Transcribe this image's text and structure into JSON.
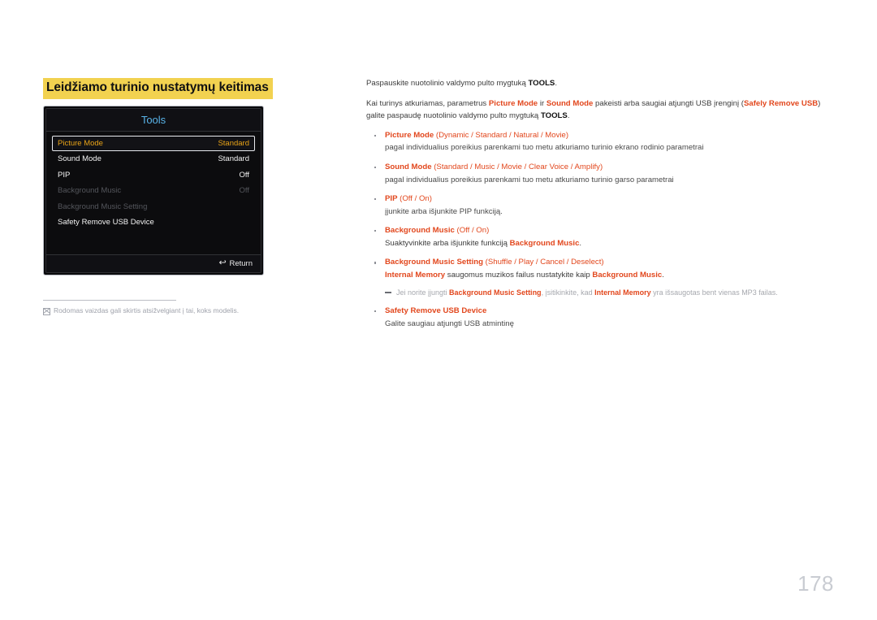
{
  "section": {
    "title": "Leidžiamo turinio nustatymų keitimas",
    "highlight_color": "#f2d250"
  },
  "osd": {
    "header_title": "Tools",
    "header_color": "#59b3e8",
    "selected_color": "#e8a317",
    "rows": [
      {
        "label": "Picture Mode",
        "value": "Standard",
        "state": "selected"
      },
      {
        "label": "Sound Mode",
        "value": "Standard",
        "state": "enabled"
      },
      {
        "label": "PIP",
        "value": "Off",
        "state": "enabled"
      },
      {
        "label": "Background Music",
        "value": "Off",
        "state": "disabled"
      },
      {
        "label": "Background Music Setting",
        "value": "",
        "state": "disabled"
      },
      {
        "label": "Safety Remove USB Device",
        "value": "",
        "state": "enabled"
      }
    ],
    "return_label": "Return",
    "return_icon": "return-arrow-icon"
  },
  "footnote": {
    "icon": "note-box-icon",
    "text": "Rodomas vaizdas gali skirtis atsižvelgiant į tai, koks modelis."
  },
  "body": {
    "paragraph1": {
      "pre": "Paspauskite nuotolinio valdymo pulto mygtuką ",
      "emphasis": "TOOLS",
      "post": "."
    },
    "paragraph2": {
      "p1": "Kai turinys atkuriamas, parametrus ",
      "e1": "Picture Mode",
      "p2": " ir ",
      "e2": "Sound Mode",
      "p3": " pakeisti arba saugiai atjungti USB įrenginį (",
      "e3": "Safely Remove USB",
      "p4": ") galite paspaudę nuotolinio valdymo pulto mygtuką ",
      "e4": "TOOLS",
      "p5": "."
    },
    "bullets": [
      {
        "name": "picture-mode",
        "title_main": "Picture Mode",
        "title_options": " (Dynamic / Standard / Natural / Movie)",
        "desc": "pagal individualius poreikius parenkami tuo metu atkuriamo turinio ekrano rodinio parametrai"
      },
      {
        "name": "sound-mode",
        "title_main": "Sound Mode",
        "title_options": " (Standard / Music / Movie / Clear Voice / Amplify)",
        "desc": "pagal individualius poreikius parenkami tuo metu atkuriamo turinio garso parametrai"
      },
      {
        "name": "pip",
        "title_main": "PIP",
        "title_options": " (Off / On)",
        "desc": "įjunkite arba išjunkite PIP funkciją."
      },
      {
        "name": "background-music",
        "title_main": "Background Music",
        "title_options": " (Off / On)",
        "desc_pre": "Suaktyvinkite arba išjunkite funkciją ",
        "desc_em": "Background Music",
        "desc_post": "."
      },
      {
        "name": "background-music-setting",
        "title_main": "Background Music Setting",
        "title_options": " (Shuffle / Play / Cancel / Deselect)",
        "desc_em1": "Internal Memory",
        "desc_mid": " saugomus muzikos failus nustatykite kaip ",
        "desc_em2": "Background Music",
        "desc_post": ".",
        "subnote": {
          "s1": "Jei norite įjungti ",
          "e1": "Background Music Setting",
          "s2": ", įsitikinkite, kad ",
          "e2": "Internal Memory",
          "s3": " yra išsaugotas bent vienas MP3 failas."
        }
      },
      {
        "name": "safety-remove-usb-device",
        "title_main": "Safety Remove USB Device",
        "title_options": "",
        "desc": "Galite saugiau atjungti USB atmintinę"
      }
    ]
  },
  "page_number": "178"
}
